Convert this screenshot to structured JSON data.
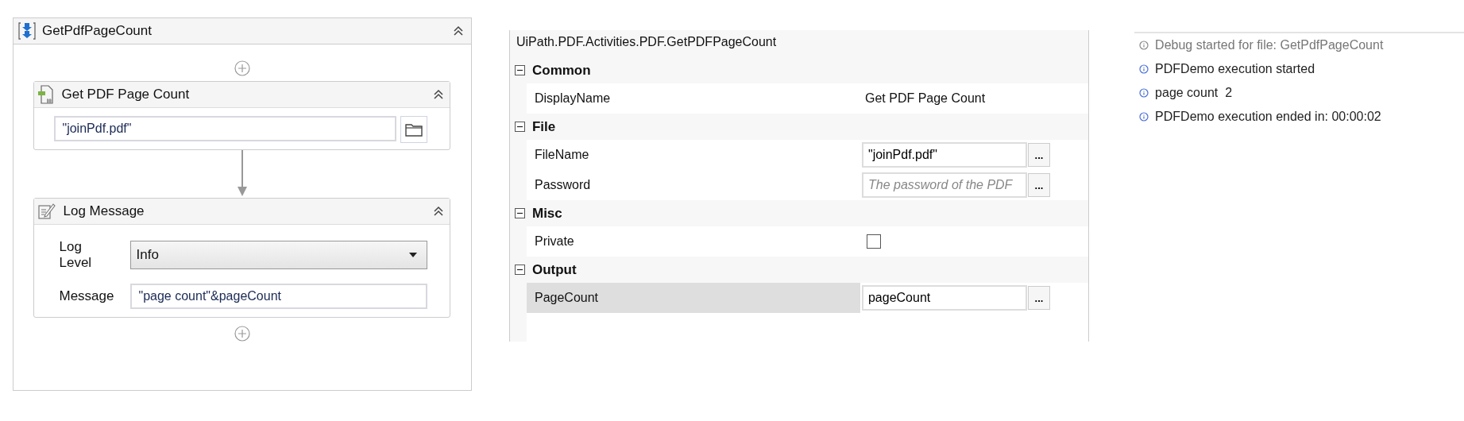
{
  "sequence": {
    "title": "GetPdfPageCount",
    "collapsed": false,
    "activities": [
      {
        "kind": "file",
        "title": "Get PDF Page Count",
        "collapsed": false,
        "file_value": "\"joinPdf.pdf\""
      },
      {
        "kind": "log",
        "title": "Log Message",
        "collapsed": false,
        "level_label": "Log Level",
        "level_value": "Info",
        "message_label": "Message",
        "message_value": "\"page count\"&pageCount"
      }
    ]
  },
  "properties": {
    "title": "UiPath.PDF.Activities.PDF.GetPDFPageCount",
    "categories": [
      {
        "name": "Common",
        "expanded": true,
        "rows": [
          {
            "kind": "text",
            "name": "DisplayName",
            "value": "Get PDF Page Count",
            "selected": false
          }
        ]
      },
      {
        "name": "File",
        "expanded": true,
        "rows": [
          {
            "kind": "input",
            "name": "FileName",
            "value": "\"joinPdf.pdf\"",
            "button_label": "...",
            "selected": false
          },
          {
            "kind": "input",
            "name": "Password",
            "placeholder": "The password of the PDF",
            "button_label": "...",
            "selected": false
          }
        ]
      },
      {
        "name": "Misc",
        "expanded": true,
        "rows": [
          {
            "kind": "checkbox",
            "name": "Private",
            "checked": false,
            "selected": false
          }
        ]
      },
      {
        "name": "Output",
        "expanded": true,
        "rows": [
          {
            "kind": "input",
            "name": "PageCount",
            "value": "pageCount",
            "button_label": "...",
            "selected": true
          }
        ]
      }
    ]
  },
  "output": {
    "entries": [
      {
        "kind": "debug",
        "text": "Debug started for file: GetPdfPageCount"
      },
      {
        "kind": "info",
        "text": "PDFDemo execution started"
      },
      {
        "kind": "info",
        "text": "page count  2"
      },
      {
        "kind": "info",
        "text": "PDFDemo execution ended in: 00:00:02"
      }
    ]
  }
}
